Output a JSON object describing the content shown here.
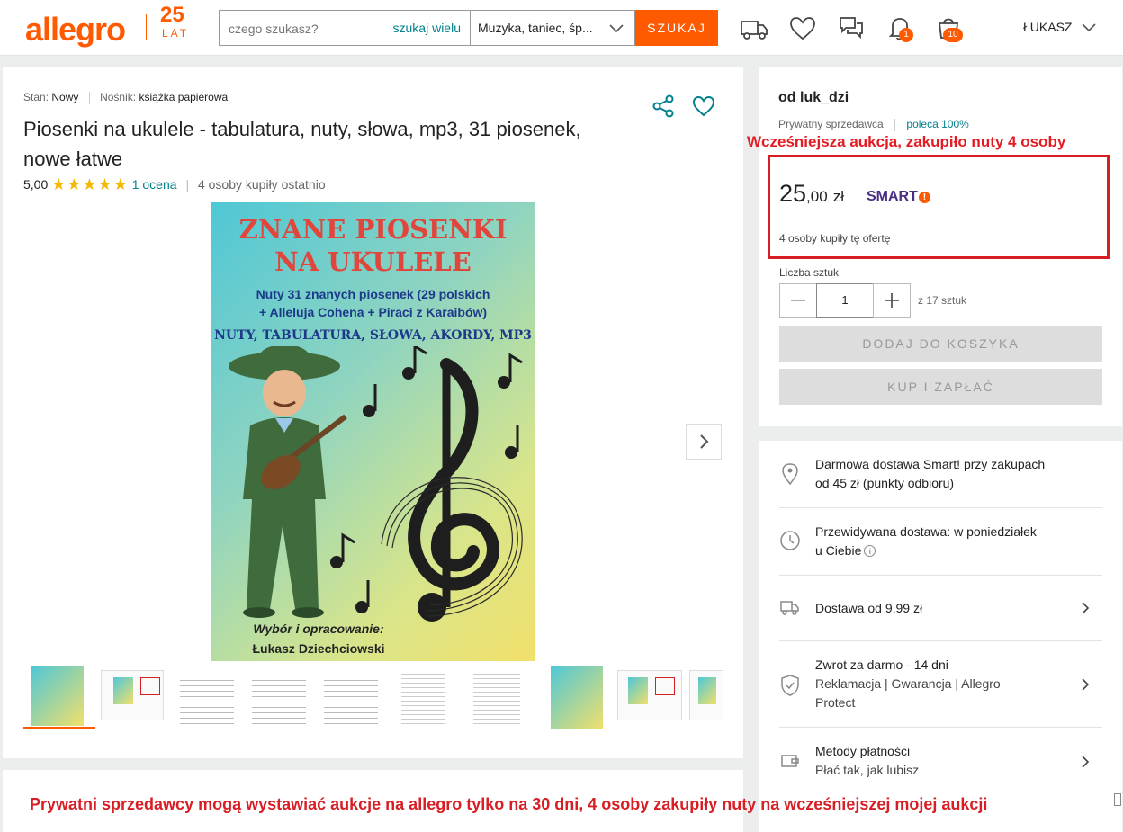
{
  "header": {
    "logo": "allegro",
    "logo_25": "25",
    "logo_lat": "LAT",
    "search_placeholder": "czego szukasz?",
    "search_multi": "szukaj wielu",
    "category": "Muzyka, taniec, śp...",
    "search_button": "SZUKAJ",
    "notifications_count": "1",
    "cart_count": "10",
    "user": "ŁUKASZ",
    "icons": [
      "truck-icon",
      "heart-icon",
      "chat-icon",
      "bell-icon",
      "cart-icon"
    ]
  },
  "product": {
    "condition_label": "Stan:",
    "condition_value": "Nowy",
    "medium_label": "Nośnik:",
    "medium_value": "książka papierowa",
    "title": "Piosenki na ukulele - tabulatura, nuty, słowa, mp3, 31 piosenek, nowe łatwe",
    "rating": "5,00",
    "stars": "★★★★★",
    "rating_count": "1 ocena",
    "rating_sep": "|",
    "bought_recently": "4 osoby kupiły ostatnio",
    "cover": {
      "title_line1": "ZNANE PIOSENKI",
      "title_line2": "NA UKULELE",
      "subtitle_line1": "Nuty 31 znanych piosenek (29 polskich",
      "subtitle_line2": "+ Alleluja Cohena + Piraci z Karaibów)",
      "subtitle_line3": "NUTY, TABULATURA, SŁOWA, AKORDY, MP3",
      "author_label": "Wybór i opracowanie:",
      "author": "Łukasz Dziechciowski"
    },
    "thumbnail_count": 10
  },
  "seller": {
    "name": "od luk_dzi",
    "type": "Prywatny sprzedawca",
    "recommend": "poleca 100%"
  },
  "annotations": {
    "top": "Wcześniejsza aukcja, zakupiło nuty 4 osoby",
    "bottom": "Prywatni sprzedawcy mogą wystawiać aukcje na allegro tylko na 30 dni,  4 osoby zakupiły nuty na wcześniejszej mojej aukcji"
  },
  "offer": {
    "price_int": "25",
    "price_dec": ",00",
    "currency": "zł",
    "smart": "SMART",
    "bought": "4 osoby kupiły tę ofertę",
    "qty_label": "Liczba sztuk",
    "qty_value": "1",
    "qty_of": "z 17 sztuk",
    "add_to_cart": "DODAJ DO KOSZYKA",
    "buy_now": "KUP I ZAPŁAĆ"
  },
  "delivery": {
    "free_line1": "Darmowa dostawa Smart! przy zakupach",
    "free_line2": "od 45 zł (punkty odbioru)",
    "expected_line1": "Przewidywana dostawa: w poniedziałek",
    "expected_line2": "u Ciebie",
    "shipping": "Dostawa od 9,99 zł",
    "return_title": "Zwrot za darmo - 14 dni",
    "return_line1": "Reklamacja | Gwarancja | Allegro",
    "return_line2": "Protect",
    "payment_title": "Metody płatności",
    "payment_sub": "Płać tak, jak lubisz"
  },
  "colors": {
    "brand": "#ff5a00",
    "link": "#00808b",
    "annotation": "#d81e25"
  }
}
